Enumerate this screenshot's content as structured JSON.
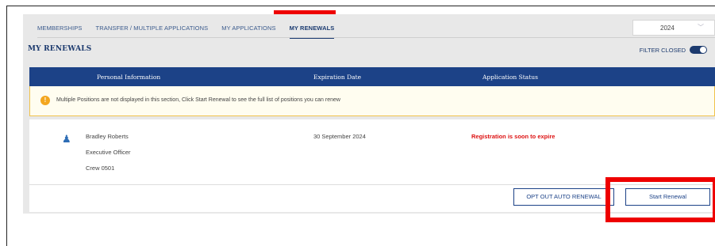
{
  "tabs": [
    {
      "label": "MEMBERSHIPS"
    },
    {
      "label": "TRANSFER / MULTIPLE APPLICATIONS"
    },
    {
      "label": "MY APPLICATIONS"
    },
    {
      "label": "MY RENEWALS"
    }
  ],
  "year_select": {
    "value": "2024",
    "chevron": "chevron-down-icon"
  },
  "section": {
    "title": "MY RENEWALS",
    "filter_label": "FILTER CLOSED",
    "filter_on": true
  },
  "table": {
    "headers": [
      "Personal Information",
      "Expiration Date",
      "Application Status"
    ]
  },
  "notice": {
    "icon": "warning-icon",
    "text": "Multiple Positions are not displayed in this section, Click Start Renewal to see the full list of positions you can renew"
  },
  "renewal": {
    "name": "Bradley Roberts",
    "role": "Executive Officer",
    "crew": "Crew 0501",
    "expiration": "30 September 2024",
    "status": "Registration is soon to expire",
    "status_color": "#dd1111"
  },
  "buttons": {
    "opt_out": "OPT OUT AUTO RENEWAL",
    "start": "Start Renewal"
  },
  "colors": {
    "primary": "#1c4287",
    "highlight": "#ee0000",
    "notice_border": "#f0c24b"
  }
}
